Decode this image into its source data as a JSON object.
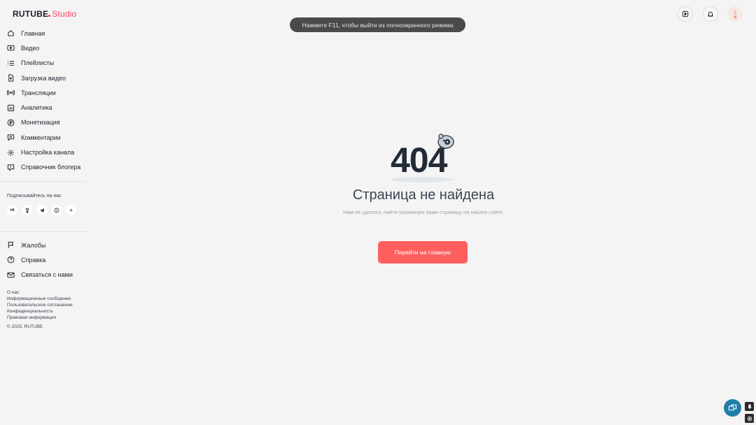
{
  "logo": {
    "brand": "RUTUBE",
    "product": "Studio"
  },
  "nav": [
    {
      "label": "Главная",
      "icon": "home-icon"
    },
    {
      "label": "Видео",
      "icon": "video-icon"
    },
    {
      "label": "Плейлисты",
      "icon": "playlist-icon"
    },
    {
      "label": "Загрузка видео",
      "icon": "upload-icon"
    },
    {
      "label": "Трансляции",
      "icon": "broadcast-icon"
    },
    {
      "label": "Аналитика",
      "icon": "analytics-icon"
    },
    {
      "label": "Монетизация",
      "icon": "ruble-icon"
    },
    {
      "label": "Комментарии",
      "icon": "comment-icon"
    },
    {
      "label": "Настройка канала",
      "icon": "gear-icon"
    },
    {
      "label": "Справочник блогера",
      "icon": "info-icon"
    }
  ],
  "subscribe": {
    "title": "Подписывайтесь на нас",
    "networks": [
      "vk-icon",
      "ok-icon",
      "telegram-icon",
      "viber-icon",
      "plus-icon"
    ]
  },
  "nav_secondary": [
    {
      "label": "Жалобы",
      "icon": "flag-icon"
    },
    {
      "label": "Справка",
      "icon": "help-icon"
    },
    {
      "label": "Связаться с нами",
      "icon": "mail-icon"
    }
  ],
  "footer": {
    "links": [
      "О нас",
      "Информационные сообщения",
      "Пользовательское соглашение",
      "Конфиденциальность",
      "Правовая информация"
    ],
    "copyright": "© 2025, RUTUBE"
  },
  "toast": "Нажмите F11, чтобы выйти из полноэкранного режима",
  "error": {
    "code": "404",
    "title": "Страница не найдена",
    "subtitle": "Нам не удалось найти указанную вами страницу на нашем сайте.",
    "button": "Перейти на главную"
  },
  "colors": {
    "accent": "#ff5e5e",
    "brand_red": "#ff3f5c",
    "background": "#f4f4f4"
  }
}
